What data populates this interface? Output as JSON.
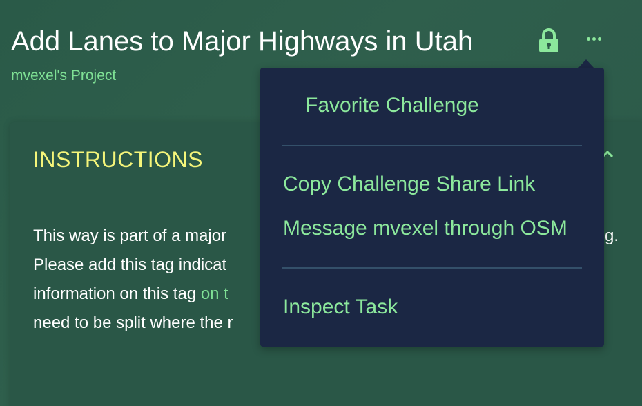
{
  "header": {
    "title": "Add Lanes to Major Highways in Utah",
    "project_link": "mvexel's Project",
    "lock_icon": "lock-icon",
    "more_icon": "ellipsis-icon"
  },
  "panel": {
    "heading": "INSTRUCTIONS",
    "chevron_icon": "chevron-icon",
    "lines": [
      "This way is part of a major",
      "Please add this tag indicat",
      "information on this tag ",
      "need to be split where the r"
    ],
    "link_fragment": "on t",
    "line1_tail": "g."
  },
  "menu": {
    "favorite": "Favorite Challenge",
    "copy_link": "Copy Challenge Share Link",
    "message": "Message mvexel through OSM",
    "inspect": "Inspect Task"
  },
  "colors": {
    "accent": "#8ce89c",
    "heading": "#f5f57a",
    "menu_bg": "#1b2744",
    "page_bg": "#2c5a49"
  }
}
